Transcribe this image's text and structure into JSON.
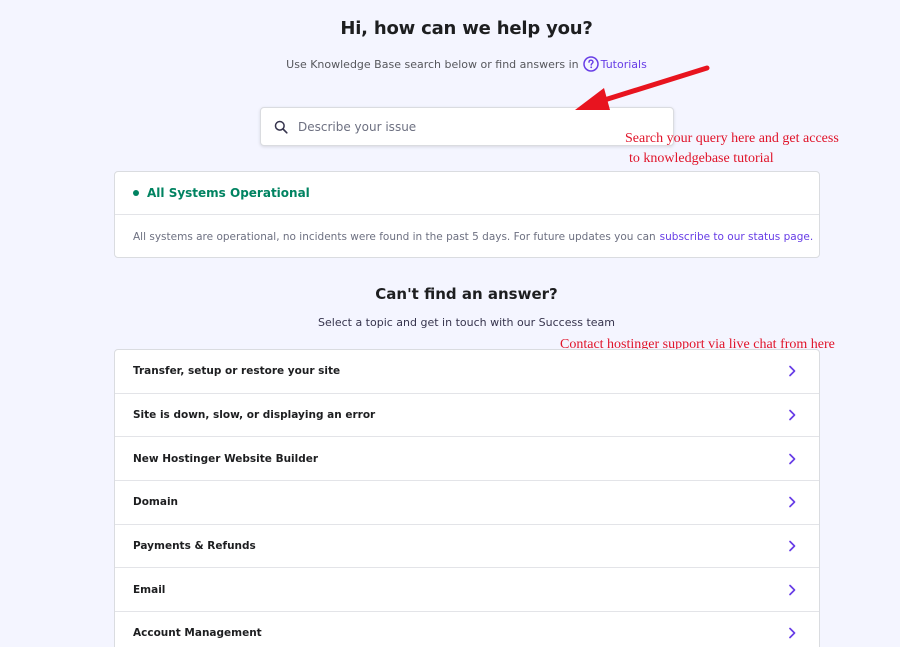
{
  "header": {
    "title": "Hi, how can we help you?",
    "subtitle": "Use Knowledge Base search below or find answers in",
    "tutorials_label": "Tutorials"
  },
  "search": {
    "placeholder": "Describe your issue"
  },
  "annotations": {
    "search_note_line1": "Search your query here and get access",
    "search_note_line2": "to knowledgebase tutorial",
    "chat_note": "Contact hostinger support via live chat from here",
    "color": "#e0142a"
  },
  "status": {
    "title": "All Systems Operational",
    "message": "All systems are operational, no incidents were found in the past 5 days. For future updates you can",
    "link_label": "subscribe to our status page.",
    "color": "#008361"
  },
  "support": {
    "title": "Can't find an answer?",
    "subtitle": "Select a topic and get in touch with our Success team",
    "topics": [
      {
        "label": "Transfer, setup or restore your site"
      },
      {
        "label": "Site is down, slow, or displaying an error"
      },
      {
        "label": "New Hostinger Website Builder"
      },
      {
        "label": "Domain"
      },
      {
        "label": "Payments & Refunds"
      },
      {
        "label": "Email"
      },
      {
        "label": "Account Management"
      }
    ]
  },
  "colors": {
    "accent": "#673de6",
    "background": "#f4f5ff"
  }
}
